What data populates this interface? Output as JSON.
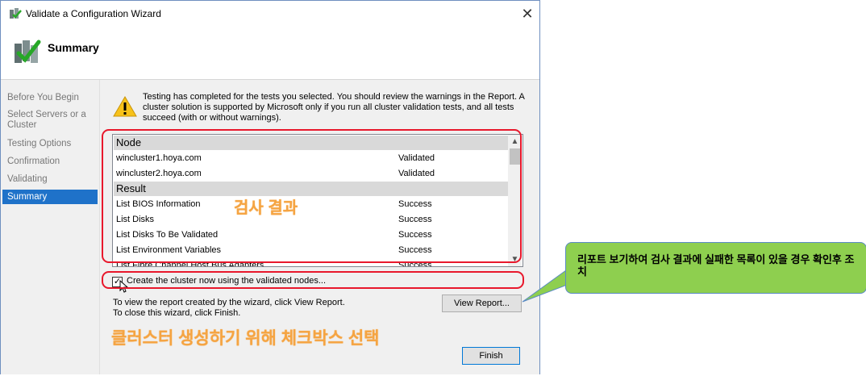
{
  "window": {
    "title": "Validate a Configuration Wizard",
    "page_title": "Summary",
    "close_glyph": "✕"
  },
  "nav": {
    "items": [
      {
        "label": "Before You Begin",
        "active": false
      },
      {
        "label": "Select Servers or a Cluster",
        "active": false
      },
      {
        "label": "Testing Options",
        "active": false
      },
      {
        "label": "Confirmation",
        "active": false
      },
      {
        "label": "Validating",
        "active": false
      },
      {
        "label": "Summary",
        "active": true
      }
    ]
  },
  "summary": {
    "warning_text": "Testing has completed for the tests you selected. You should review the warnings in the Report.  A cluster solution is supported by Microsoft only if you run all cluster validation tests, and all tests succeed (with or without warnings).",
    "groups": [
      {
        "header": "Node",
        "rows": [
          {
            "name": "wincluster1.hoya.com",
            "status": "Validated"
          },
          {
            "name": "wincluster2.hoya.com",
            "status": "Validated"
          }
        ]
      },
      {
        "header": "Result",
        "rows": [
          {
            "name": "List BIOS Information",
            "status": "Success"
          },
          {
            "name": "List Disks",
            "status": "Success"
          },
          {
            "name": "List Disks To Be Validated",
            "status": "Success"
          },
          {
            "name": "List Environment Variables",
            "status": "Success"
          },
          {
            "name": "List Fibre Channel Host Bus Adapters",
            "status": "Success"
          }
        ]
      }
    ],
    "checkbox_label": "Create the cluster now using the validated nodes...",
    "checkbox_checked": true,
    "info_line1": "To view the report created by the wizard, click View Report.",
    "info_line2": "To close this wizard, click Finish.",
    "view_report_label": "View Report...",
    "finish_label": "Finish"
  },
  "annotations": {
    "result_label": "검사 결과",
    "checkbox_instruction": "클러스터 생성하기 위해 체크박스 선택",
    "callout_text": "리포트 보기하여 검사 결과에 실패한 목록이 있을 경우 확인후 조치",
    "colors": {
      "highlight_border": "#e8182c",
      "orange_text": "#f5a442",
      "callout_bg": "#8ecf4f",
      "accent_blue": "#1f72c9"
    }
  }
}
